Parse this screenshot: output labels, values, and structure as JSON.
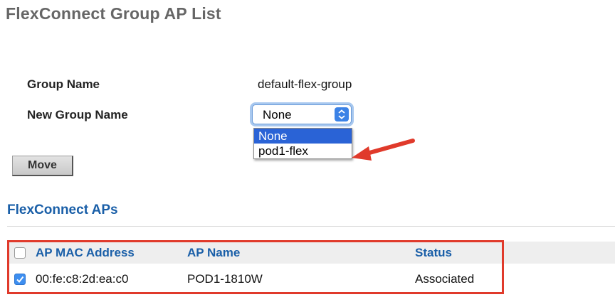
{
  "page": {
    "title": "FlexConnect Group AP List"
  },
  "form": {
    "group_name_label": "Group Name",
    "group_name_value": "default-flex-group",
    "new_group_name_label": "New Group Name",
    "new_group_selected": "None",
    "new_group_options": [
      "None",
      "pod1-flex"
    ],
    "move_button": "Move"
  },
  "aps_section": {
    "title": "FlexConnect APs",
    "columns": [
      "AP MAC Address",
      "AP Name",
      "Status"
    ],
    "rows": [
      {
        "checked": true,
        "mac": "00:fe:c8:2d:ea:c0",
        "name": "POD1-1810W",
        "status": "Associated"
      }
    ]
  },
  "colors": {
    "title_gray": "#666666",
    "link_blue": "#1a5fa8",
    "highlight_red": "#e03a2b",
    "selection_blue": "#2a63d6"
  },
  "icons": {
    "select_arrows": "updown-chevron-icon",
    "annotation": "red-arrow-icon",
    "checkbox": "checkmark-icon"
  }
}
